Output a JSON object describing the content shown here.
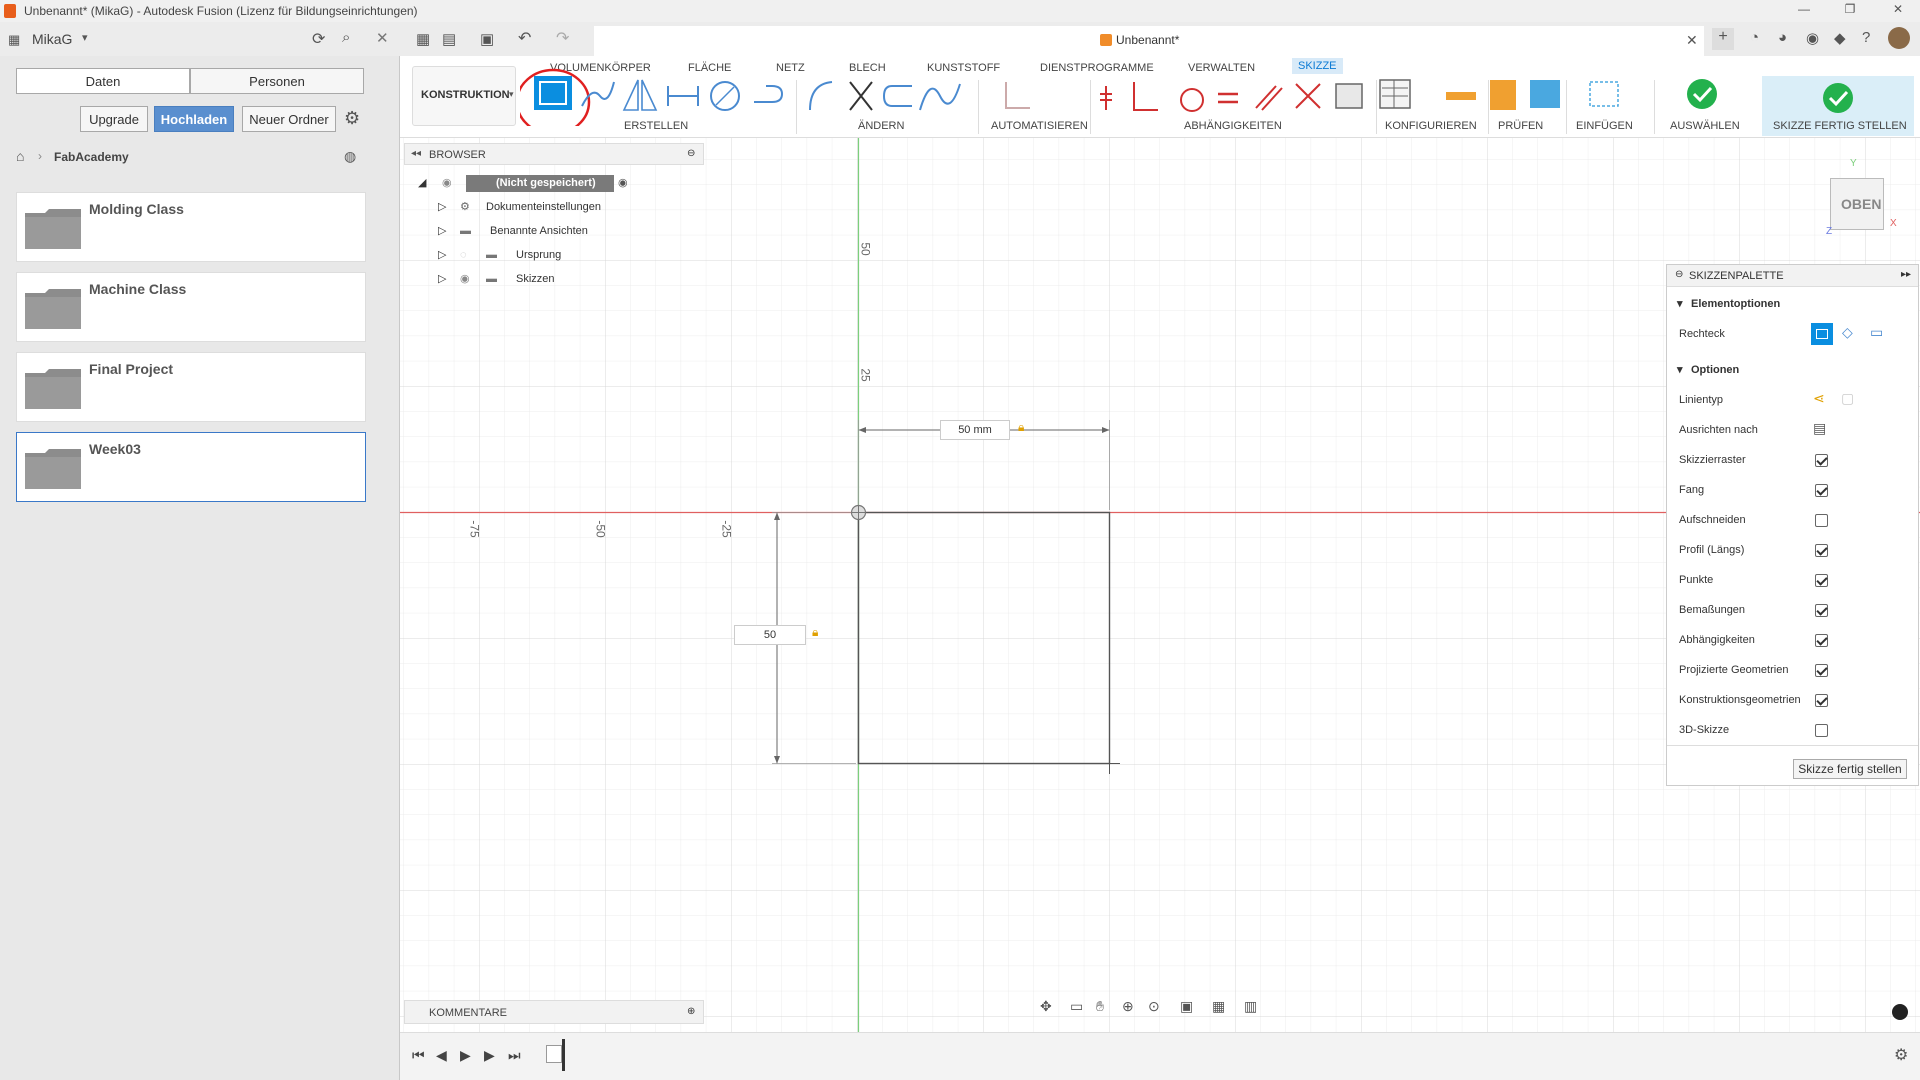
{
  "window": {
    "title": "Unbenannt* (MikaG) - Autodesk Fusion (Lizenz für Bildungseinrichtungen)",
    "document_tab": "Unbenannt*"
  },
  "leftpanel": {
    "user": "MikaG",
    "tabs": [
      "Daten",
      "Personen"
    ],
    "buttons": {
      "upgrade": "Upgrade",
      "upload": "Hochladen",
      "new_folder": "Neuer Ordner"
    },
    "breadcrumb": "FabAcademy",
    "folders": [
      "Molding Class",
      "Machine Class",
      "Final Project",
      "Week03"
    ]
  },
  "toolbar": {
    "workspace": "KONSTRUKTION",
    "tabs": [
      "VOLUMENKÖRPER",
      "FLÄCHE",
      "NETZ",
      "BLECH",
      "KUNSTSTOFF",
      "DIENSTPROGRAMME",
      "VERWALTEN",
      "SKIZZE"
    ],
    "active_tab": "SKIZZE",
    "groups": {
      "erstellen": "ERSTELLEN",
      "aendern": "ÄNDERN",
      "automatisieren": "AUTOMATISIEREN",
      "abhaengigkeiten": "ABHÄNGIGKEITEN",
      "konfigurieren": "KONFIGURIEREN",
      "pruefen": "PRÜFEN",
      "einfuegen": "EINFÜGEN",
      "auswaehlen": "AUSWÄHLEN",
      "finish": "SKIZZE FERTIG STELLEN"
    }
  },
  "browser": {
    "title": "BROWSER",
    "root": "(Nicht gespeichert)",
    "items": [
      "Dokumenteinstellungen",
      "Benannte Ansichten",
      "Ursprung",
      "Skizzen"
    ]
  },
  "canvas": {
    "axis_labels": {
      "y50": "50",
      "y25": "25",
      "xm75": "-75",
      "xm50": "-50",
      "xm25": "-25"
    },
    "dim_width": "50 mm",
    "dim_height": "50",
    "viewcube": "OBEN",
    "viewcube_axes": {
      "x": "X",
      "y": "Y",
      "z": "Z"
    }
  },
  "palette": {
    "title": "SKIZZENPALETTE",
    "section1": "Elementoptionen",
    "rechteck_label": "Rechteck",
    "section2": "Optionen",
    "linientyp": "Linientyp",
    "ausrichten": "Ausrichten nach",
    "options": [
      {
        "label": "Skizzierraster",
        "checked": true
      },
      {
        "label": "Fang",
        "checked": true
      },
      {
        "label": "Aufschneiden",
        "checked": false
      },
      {
        "label": "Profil (Längs)",
        "checked": true
      },
      {
        "label": "Punkte",
        "checked": true
      },
      {
        "label": "Bemaßungen",
        "checked": true
      },
      {
        "label": "Abhängigkeiten",
        "checked": true
      },
      {
        "label": "Projizierte Geometrien",
        "checked": true
      },
      {
        "label": "Konstruktionsgeometrien",
        "checked": true
      },
      {
        "label": "3D-Skizze",
        "checked": false
      }
    ],
    "finish_button": "Skizze fertig stellen"
  },
  "comments": {
    "title": "KOMMENTARE"
  },
  "colors": {
    "accent": "#0696d7",
    "upload": "#5a8fcf",
    "finish_green": "#23b14d",
    "x_axis": "#e06060",
    "y_axis": "#7ccf7c",
    "highlight_circle": "#e02020"
  }
}
